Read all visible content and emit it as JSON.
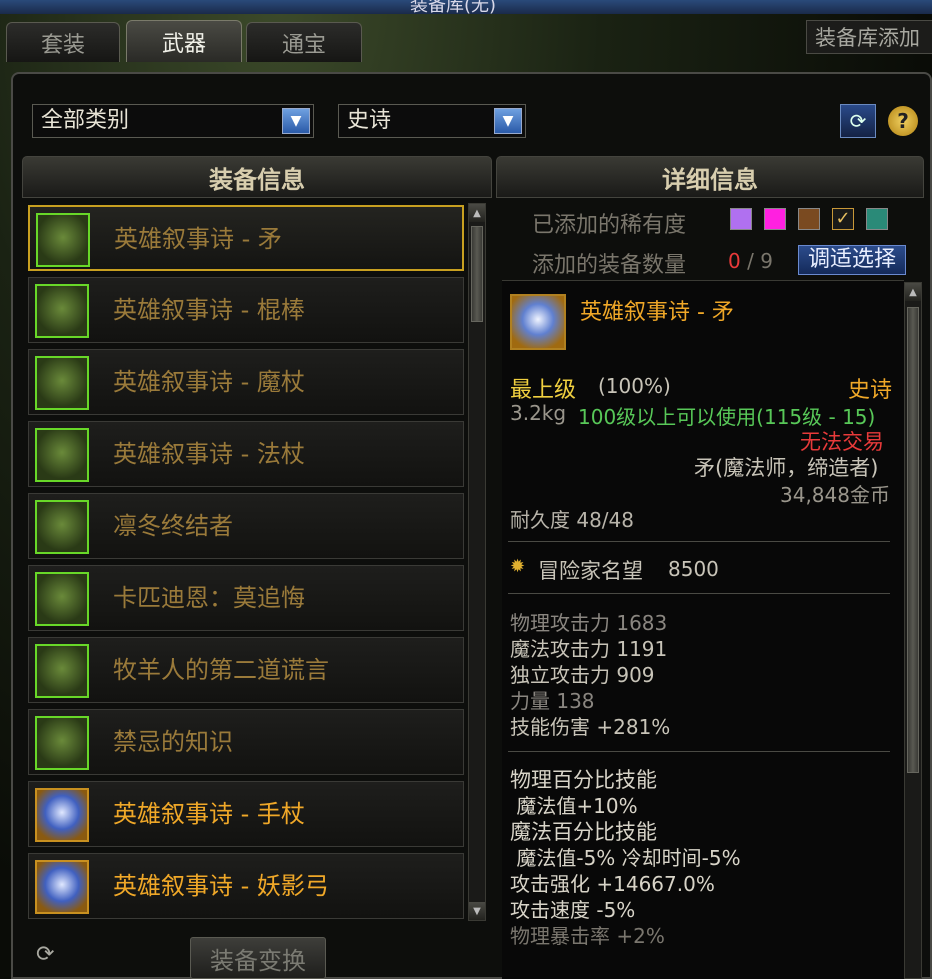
{
  "window": {
    "title": "装备库(无)"
  },
  "tabs": [
    {
      "label": "套装",
      "active": false
    },
    {
      "label": "武器",
      "active": true
    },
    {
      "label": "通宝",
      "active": false
    }
  ],
  "add_library_label": "装备库添加",
  "filters": {
    "category": "全部类别",
    "rarity": "史诗"
  },
  "left_panel": {
    "title": "装备信息",
    "items": [
      {
        "name": "英雄叙事诗 - 矛",
        "selected": true,
        "tier": "dim"
      },
      {
        "name": "英雄叙事诗 - 棍棒",
        "selected": false,
        "tier": "dim"
      },
      {
        "name": "英雄叙事诗 - 魔杖",
        "selected": false,
        "tier": "dim"
      },
      {
        "name": "英雄叙事诗 - 法杖",
        "selected": false,
        "tier": "dim"
      },
      {
        "name": "凛冬终结者",
        "selected": false,
        "tier": "dim"
      },
      {
        "name": "卡匹迪恩：莫追悔",
        "selected": false,
        "tier": "dim"
      },
      {
        "name": "牧羊人的第二道谎言",
        "selected": false,
        "tier": "dim"
      },
      {
        "name": "禁忌的知识",
        "selected": false,
        "tier": "dim"
      },
      {
        "name": "英雄叙事诗 - 手杖",
        "selected": false,
        "tier": "gold"
      },
      {
        "name": "英雄叙事诗 - 妖影弓",
        "selected": false,
        "tier": "gold"
      }
    ],
    "convert_button": "装备变换"
  },
  "right_panel": {
    "title": "详细信息",
    "rarity_label": "已添加的稀有度",
    "count_label": "添加的装备数量",
    "count_current": "0",
    "count_sep": "/",
    "count_max": "9",
    "adjust_button": "调适选择",
    "swatch_colors": [
      "#b070f0",
      "#ff20e0",
      "#7a4a20",
      "#1a1a18",
      "#2a8a78"
    ]
  },
  "detail": {
    "name": "英雄叙事诗 - 矛",
    "grade": "最上级",
    "grade_pct": "(100%)",
    "rarity": "史诗",
    "weight": "3.2kg",
    "level_req": "100级以上可以使用(115级 - 15)",
    "trade": "无法交易",
    "type": "矛(魔法师，缔造者)",
    "price": "34,848金币",
    "durability": "耐久度 48/48",
    "fame_label": "冒险家名望",
    "fame_value": "8500",
    "stats": [
      {
        "label": "物理攻击力",
        "value": "1683",
        "dim": true
      },
      {
        "label": "魔法攻击力",
        "value": "1191",
        "dim": false
      },
      {
        "label": "独立攻击力",
        "value": "909",
        "dim": false
      },
      {
        "label": "力量",
        "value": "138",
        "dim": true
      },
      {
        "label": "技能伤害",
        "value": "+281%",
        "dim": false
      }
    ],
    "effects": [
      {
        "text": "物理百分比技能",
        "dim": false
      },
      {
        "text": " 魔法值+10%",
        "dim": false
      },
      {
        "text": "魔法百分比技能",
        "dim": false
      },
      {
        "text": " 魔法值-5% 冷却时间-5%",
        "dim": false
      },
      {
        "text": "攻击强化 +14667.0%",
        "dim": false
      },
      {
        "text": "攻击速度 -5%",
        "dim": false
      },
      {
        "text": "物理暴击率 +2%",
        "dim": true
      }
    ]
  },
  "colors": {
    "gold_text": "#f0a828",
    "green_text": "#58c858",
    "red_text": "#e83a3a",
    "accent_blue": "#2a5aa8"
  }
}
